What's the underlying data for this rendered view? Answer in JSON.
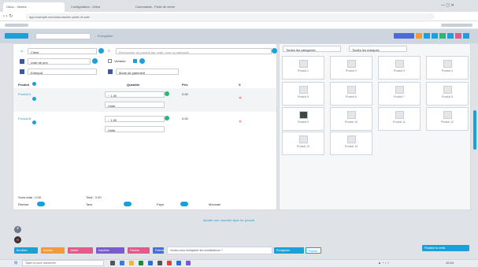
{
  "browser": {
    "tabs": [
      "Odoo - Ventes",
      "Configuration - Odoo",
      "Commande - Point de vente"
    ],
    "url": "app.example.com/odoo/action-point-of-sale"
  },
  "toolbar": {
    "actions": [
      "Enregistrer",
      "Annuler",
      "Options"
    ]
  },
  "form": {
    "customer": "Client",
    "search_placeholder": "Rechercher un produit par code, nom ou categorie",
    "pricelist": "Liste de prix",
    "variant_label": "Variante",
    "warehouse": "Entrepot",
    "payment": "Mode de paiement",
    "columns": [
      "Produit",
      "Quantite",
      "Prix",
      "X"
    ]
  },
  "rows": [
    {
      "product": "Produit A",
      "qty": "1.00",
      "unit": "Unite",
      "price": "0.00"
    },
    {
      "product": "Produit B",
      "qty": "1.00",
      "unit": "Unite",
      "price": "0.00"
    }
  ],
  "totals": {
    "subtotal_label": "Sous-total : 0.00",
    "total_label": "Total : 0.00",
    "discount_label": "Remise",
    "tax_label": "Taxe",
    "paid_label": "Paye",
    "change_label": "Monnaie"
  },
  "filters": {
    "category": "Toutes les categories",
    "brand": "Toutes les marques"
  },
  "products": [
    "Produit 1",
    "Produit 2",
    "Produit 3",
    "Produit 4",
    "Produit 5",
    "Produit 6",
    "Produit 7",
    "Produit 8",
    "Produit 9",
    "Produit 10",
    "Produit 11",
    "Produit 12",
    "Produit 13",
    "Produit 14"
  ],
  "link_text": "Ajouter une nouvelle ligne de produit",
  "bottom_buttons": [
    "Brouillon",
    "Annuler",
    "Valider",
    "Imprimer",
    "Facture",
    "Paiement"
  ],
  "right_button": "Finaliser la vente",
  "notification": "Voulez-vous enregistrer les modifications ?",
  "notification_buttons": [
    "Enregistrer",
    "Fermer"
  ],
  "taskbar": {
    "search_placeholder": "Tapez ici pour rechercher",
    "clock": "10:24"
  },
  "colors": {
    "accent": "#1ba0d8",
    "danger": "#e03c3c",
    "orange": "#f29a3a",
    "purple": "#7a5ccf",
    "green": "#2bb673"
  }
}
